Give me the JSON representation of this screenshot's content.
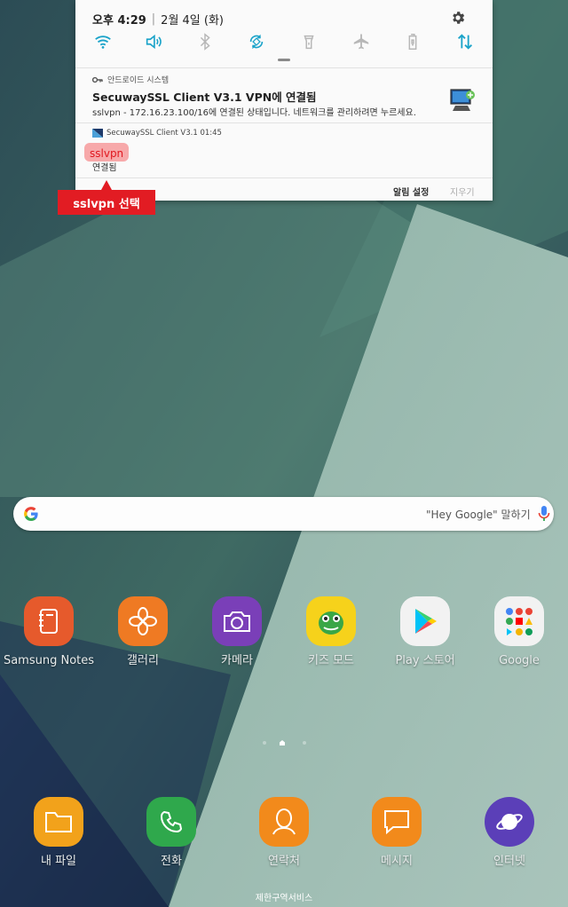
{
  "status_bar": {
    "time": "오후 4:29",
    "date": "2월 4일 (화)"
  },
  "quick_settings": {
    "icons": [
      "wifi-icon",
      "sound-icon",
      "bluetooth-icon",
      "auto-rotate-icon",
      "flashlight-icon",
      "airplane-icon",
      "power-saving-icon",
      "mobile-data-icon"
    ],
    "accent_color": "#1aa3c9"
  },
  "notifications": [
    {
      "app": "안드로이드 시스템",
      "title": "SecuwaySSL Client V3.1 VPN에 연결됨",
      "body": "sslvpn - 172.16.23.100/16에 연결된 상태입니다. 네트워크를 관리하려면 누르세요."
    },
    {
      "app": "SecuwaySSL Client V3.1 01:45",
      "title": "sslvpn",
      "body": "연결됨"
    }
  ],
  "notification_actions": {
    "settings": "알림 설정",
    "clear": "지우기"
  },
  "callout": {
    "text": "sslvpn 선택",
    "color": "#e21c23"
  },
  "search_bar": {
    "hint": "\"Hey Google\" 말하기"
  },
  "apps": [
    {
      "label": "Samsung Notes"
    },
    {
      "label": "갤러리"
    },
    {
      "label": "카메라"
    },
    {
      "label": "키즈 모드"
    },
    {
      "label": "Play 스토어"
    },
    {
      "label": "Google"
    }
  ],
  "dock": [
    {
      "label": "내 파일"
    },
    {
      "label": "전화"
    },
    {
      "label": "연락처"
    },
    {
      "label": "메시지"
    },
    {
      "label": "인터넷"
    }
  ],
  "footer": "제한구역서비스"
}
